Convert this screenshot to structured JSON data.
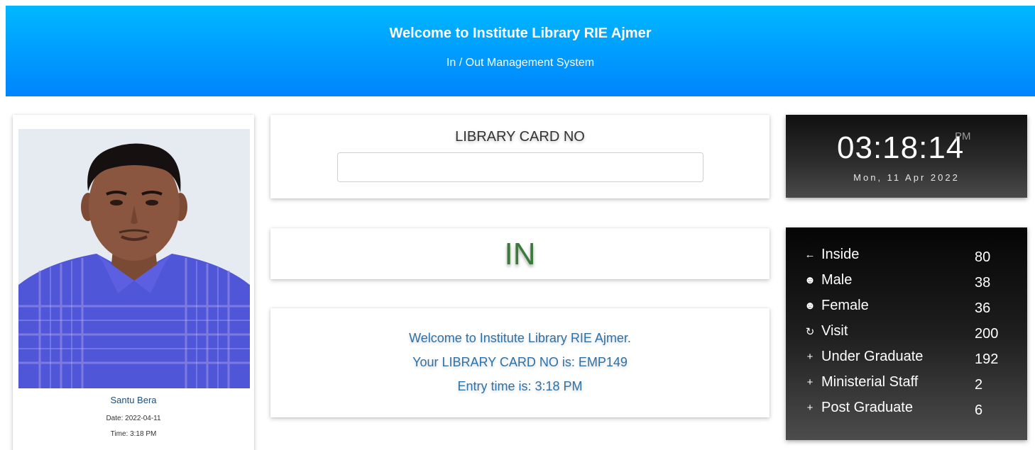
{
  "header": {
    "title": "Welcome to Institute Library RIE Ajmer",
    "subtitle": "In / Out Management System",
    "bg_start": "#00b8ff",
    "bg_end": "#0084fd"
  },
  "profile": {
    "name": "Santu Bera",
    "date": "Date: 2022-04-11",
    "time": "Time: 3:18 PM"
  },
  "card_input": {
    "label": "LIBRARY CARD NO",
    "value": "",
    "placeholder": ""
  },
  "status": {
    "text": "IN",
    "color": "#3c7a3c"
  },
  "message": {
    "line1": "Welcome to Institute Library RIE Ajmer.",
    "line2": "Your LIBRARY CARD NO is: EMP149",
    "line3": "Entry time is: 3:18 PM"
  },
  "clock": {
    "time": "03:18:14",
    "ampm": "PM",
    "date": "Mon, 11 Apr 2022"
  },
  "stats": [
    {
      "icon": "arrow-left-icon",
      "label": "Inside",
      "value": "80"
    },
    {
      "icon": "male-face-icon",
      "label": "Male",
      "value": "38"
    },
    {
      "icon": "female-face-icon",
      "label": "Female",
      "value": "36"
    },
    {
      "icon": "refresh-icon",
      "label": "Visit",
      "value": "200"
    },
    {
      "icon": "plus-icon",
      "label": "Under Graduate",
      "value": "192"
    },
    {
      "icon": "plus-icon",
      "label": "Ministerial Staff",
      "value": "2"
    },
    {
      "icon": "plus-icon",
      "label": "Post Graduate",
      "value": "6"
    }
  ]
}
